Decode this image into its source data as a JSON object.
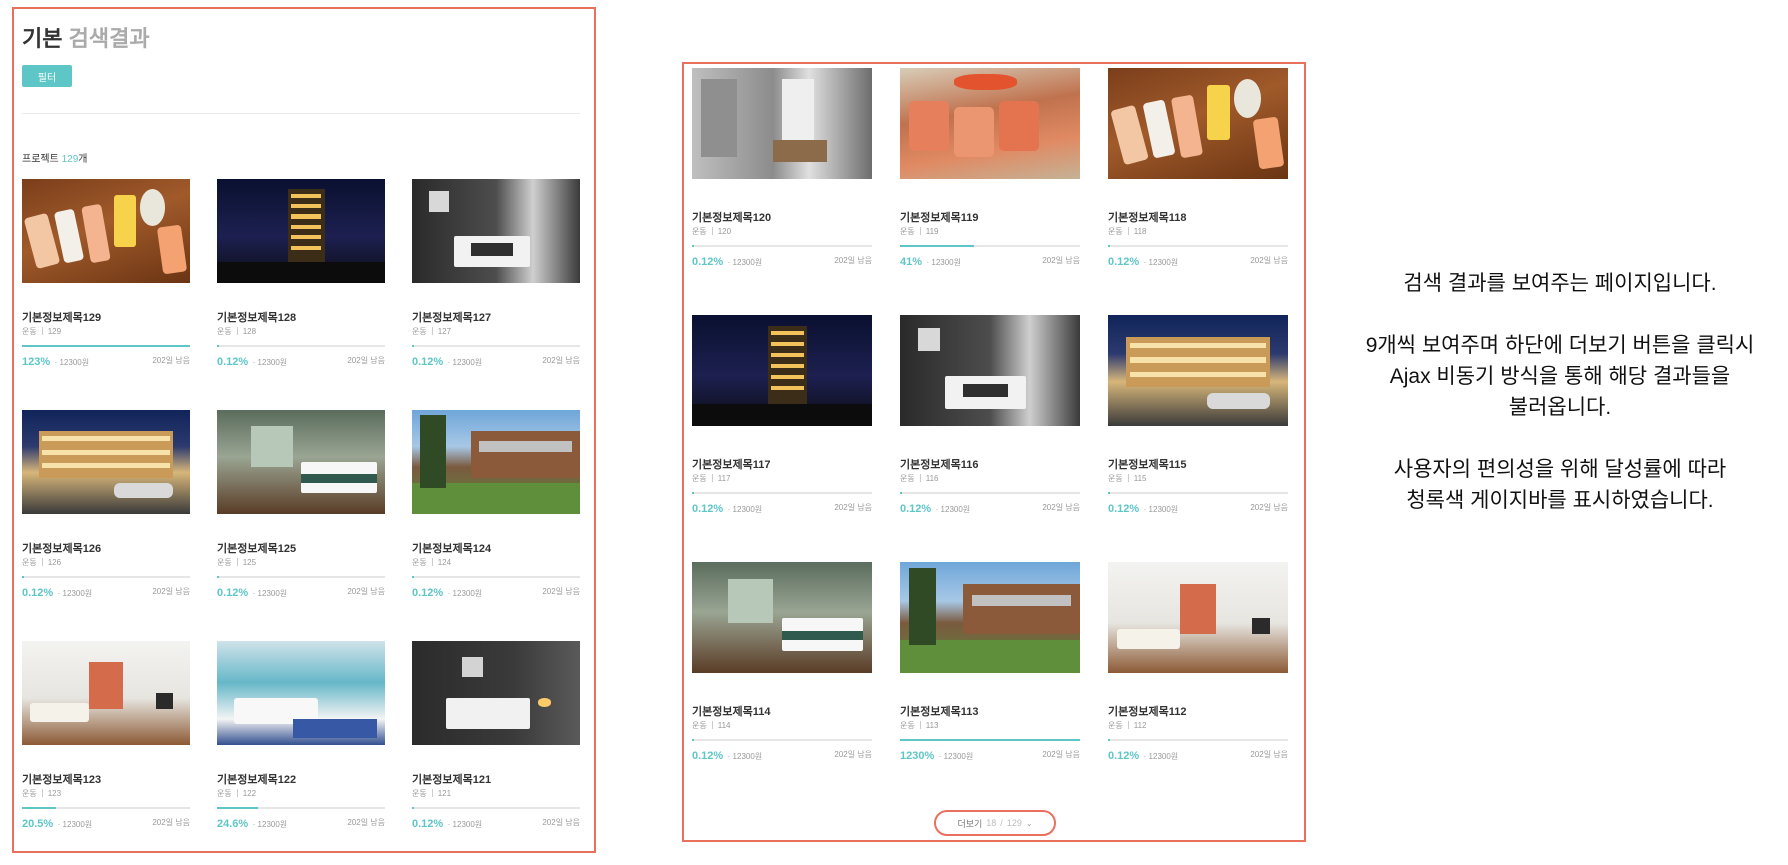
{
  "left_panel": {
    "title": "기본",
    "title_sub": "검색결과",
    "filter_label": "필터",
    "count_prefix": "프로젝트 ",
    "count_num": "129",
    "count_suffix": "개",
    "cards": [
      {
        "title": "기본정보제목129",
        "category": "운동",
        "id": "129",
        "percent": "123%",
        "progress": 1.0,
        "amount": "· 12300원",
        "days": "202일 남음",
        "image": "sushi"
      },
      {
        "title": "기본정보제목128",
        "category": "운동",
        "id": "128",
        "percent": "0.12%",
        "progress": 0.01,
        "amount": "· 12300원",
        "days": "202일 남음",
        "image": "night"
      },
      {
        "title": "기본정보제목127",
        "category": "운동",
        "id": "127",
        "percent": "0.12%",
        "progress": 0.01,
        "amount": "· 12300원",
        "days": "202일 남음",
        "image": "room-dark"
      },
      {
        "title": "기본정보제목126",
        "category": "운동",
        "id": "126",
        "percent": "0.12%",
        "progress": 0.01,
        "amount": "· 12300원",
        "days": "202일 남음",
        "image": "motel"
      },
      {
        "title": "기본정보제목125",
        "category": "운동",
        "id": "125",
        "percent": "0.12%",
        "progress": 0.01,
        "amount": "· 12300원",
        "days": "202일 남음",
        "image": "room-green"
      },
      {
        "title": "기본정보제목124",
        "category": "운동",
        "id": "124",
        "percent": "0.12%",
        "progress": 0.01,
        "amount": "· 12300원",
        "days": "202일 남음",
        "image": "house"
      },
      {
        "title": "기본정보제목123",
        "category": "운동",
        "id": "123",
        "percent": "20.5%",
        "progress": 0.205,
        "amount": "· 12300원",
        "days": "202일 남음",
        "image": "white-room"
      },
      {
        "title": "기본정보제목122",
        "category": "운동",
        "id": "122",
        "percent": "24.6%",
        "progress": 0.246,
        "amount": "· 12300원",
        "days": "202일 남음",
        "image": "ocean"
      },
      {
        "title": "기본정보제목121",
        "category": "운동",
        "id": "121",
        "percent": "0.12%",
        "progress": 0.01,
        "amount": "· 12300원",
        "days": "202일 남음",
        "image": "room-dark2"
      }
    ]
  },
  "right_panel": {
    "cards": [
      {
        "title": "기본정보제목120",
        "category": "운동",
        "id": "120",
        "percent": "0.12%",
        "progress": 0.01,
        "amount": "· 12300원",
        "days": "202일 남음",
        "image": "gray-room"
      },
      {
        "title": "기본정보제목119",
        "category": "운동",
        "id": "119",
        "percent": "41%",
        "progress": 0.41,
        "amount": "· 12300원",
        "days": "202일 남음",
        "image": "salmon"
      },
      {
        "title": "기본정보제목118",
        "category": "운동",
        "id": "118",
        "percent": "0.12%",
        "progress": 0.01,
        "amount": "· 12300원",
        "days": "202일 남음",
        "image": "sushi"
      },
      {
        "title": "기본정보제목117",
        "category": "운동",
        "id": "117",
        "percent": "0.12%",
        "progress": 0.01,
        "amount": "· 12300원",
        "days": "202일 남음",
        "image": "night"
      },
      {
        "title": "기본정보제목116",
        "category": "운동",
        "id": "116",
        "percent": "0.12%",
        "progress": 0.01,
        "amount": "· 12300원",
        "days": "202일 남음",
        "image": "room-dark"
      },
      {
        "title": "기본정보제목115",
        "category": "운동",
        "id": "115",
        "percent": "0.12%",
        "progress": 0.01,
        "amount": "· 12300원",
        "days": "202일 남음",
        "image": "motel"
      },
      {
        "title": "기본정보제목114",
        "category": "운동",
        "id": "114",
        "percent": "0.12%",
        "progress": 0.01,
        "amount": "· 12300원",
        "days": "202일 남음",
        "image": "room-green"
      },
      {
        "title": "기본정보제목113",
        "category": "운동",
        "id": "113",
        "percent": "1230%",
        "progress": 1.0,
        "amount": "· 12300원",
        "days": "202일 남음",
        "image": "house"
      },
      {
        "title": "기본정보제목112",
        "category": "운동",
        "id": "112",
        "percent": "0.12%",
        "progress": 0.01,
        "amount": "· 12300원",
        "days": "202일 남음",
        "image": "white-room"
      }
    ],
    "more_button": {
      "label": "더보기",
      "current": "18",
      "divider": "/",
      "total": "129",
      "chevron": "⌄"
    }
  },
  "description": {
    "line1": "검색 결과를 보여주는 페이지입니다.",
    "line2": "9개씩 보여주며 하단에 더보기 버튼을 클릭시",
    "line3": "Ajax 비동기 방식을 통해 해당 결과들을",
    "line4": "불러옵니다.",
    "line5": "사용자의 편의성을 위해 달성률에 따라",
    "line6": "청록색 게이지바를 표시하였습니다."
  },
  "colors": {
    "accent": "#5fc6c7",
    "annotation_border": "#e8705d",
    "text": "#333333",
    "muted": "#999999"
  }
}
